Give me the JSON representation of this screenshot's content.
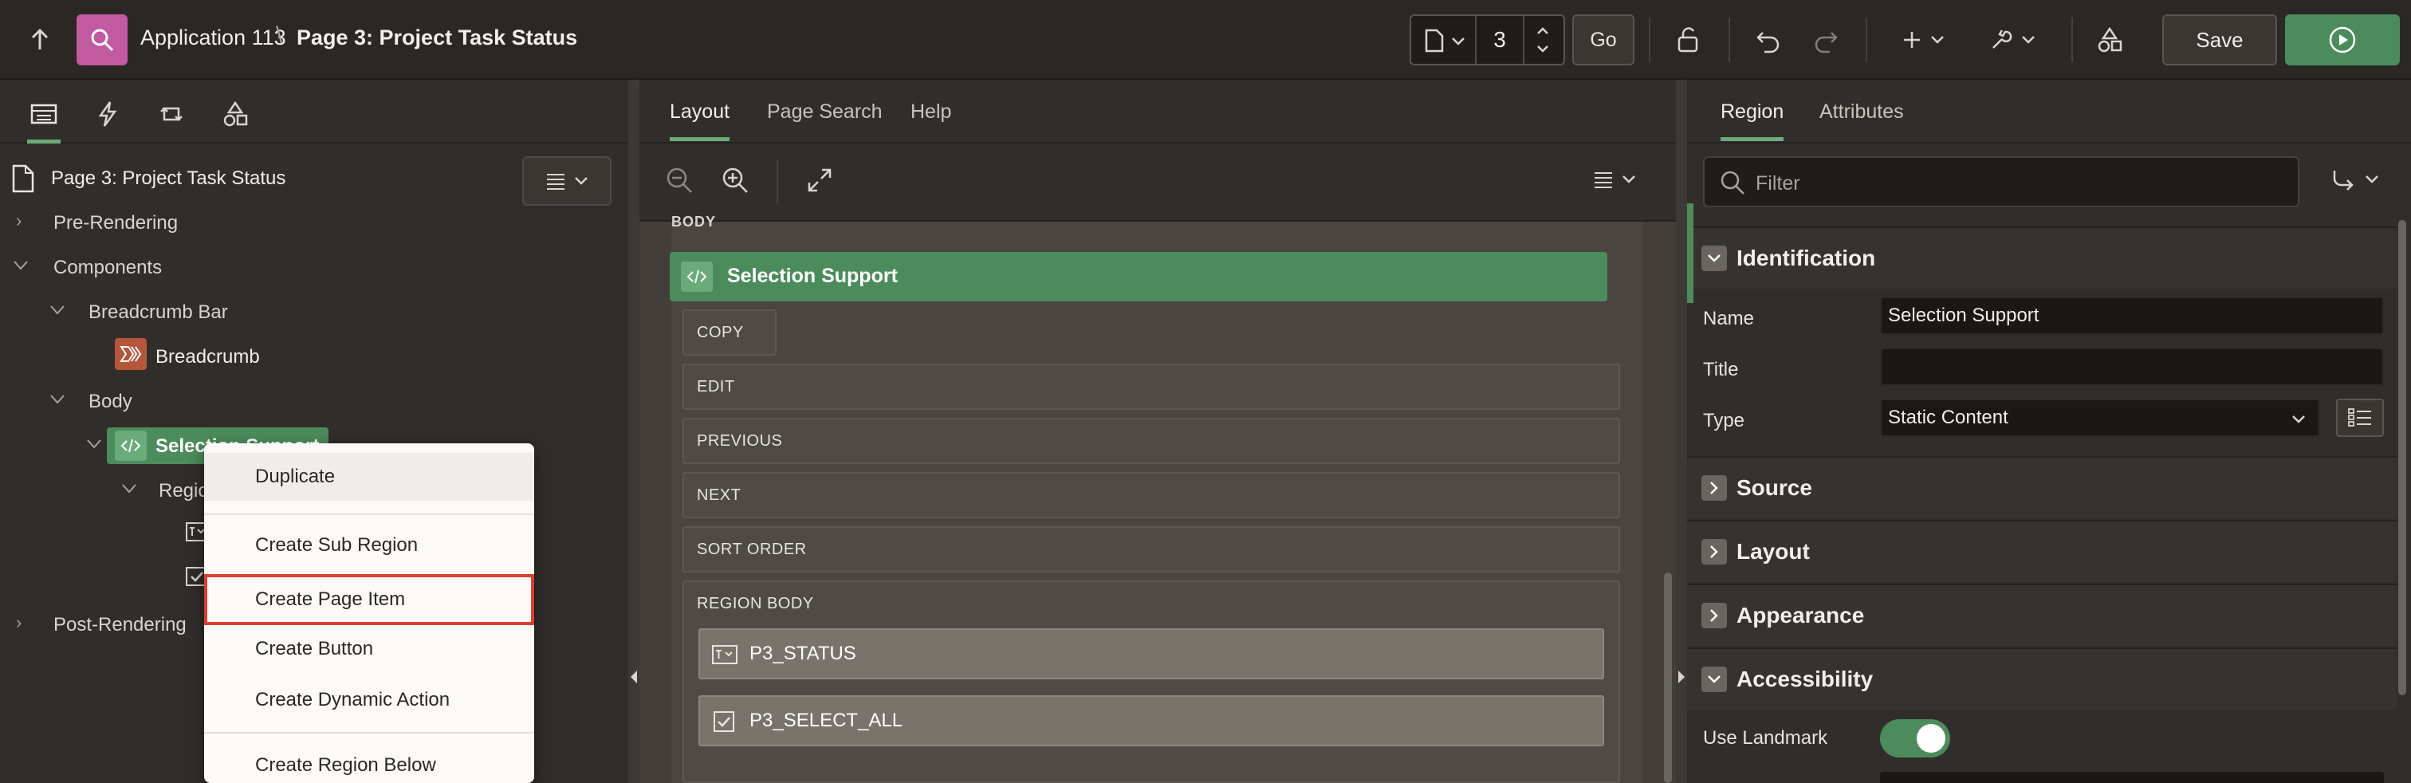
{
  "app": {
    "name": "Application 113",
    "page_title": "Page 3: Project Task Status",
    "page_number": "3",
    "go_label": "Go",
    "save_label": "Save"
  },
  "left": {
    "page_node": "Page 3: Project Task Status",
    "tree": {
      "pre_rendering": "Pre-Rendering",
      "components": "Components",
      "breadcrumb_bar": "Breadcrumb Bar",
      "breadcrumb": "Breadcrumb",
      "body": "Body",
      "selection_support": "Selection Support",
      "region_partial": "Regio",
      "post_rendering": "Post-Rendering"
    }
  },
  "context_menu": {
    "items": [
      "Duplicate",
      "Create Sub Region",
      "Create Page Item",
      "Create Button",
      "Create Dynamic Action",
      "Create Region Below"
    ]
  },
  "center": {
    "tabs": [
      "Layout",
      "Page Search",
      "Help"
    ],
    "body_label": "BODY",
    "region_title": "Selection Support",
    "slots": [
      "COPY",
      "EDIT",
      "PREVIOUS",
      "NEXT",
      "SORT ORDER",
      "REGION BODY"
    ],
    "items": [
      "P3_STATUS",
      "P3_SELECT_ALL"
    ]
  },
  "right": {
    "tabs": [
      "Region",
      "Attributes"
    ],
    "filter_placeholder": "Filter",
    "groups": {
      "identification": "Identification",
      "source": "Source",
      "layout": "Layout",
      "appearance": "Appearance",
      "accessibility": "Accessibility"
    },
    "props": {
      "name_label": "Name",
      "name_value": "Selection Support",
      "title_label": "Title",
      "title_value": "",
      "type_label": "Type",
      "type_value": "Static Content",
      "use_landmark_label": "Use Landmark"
    }
  },
  "colors": {
    "accent_green": "#4c8c5c",
    "highlight_red": "#d8412f",
    "app_logo": "#c25aa0"
  }
}
